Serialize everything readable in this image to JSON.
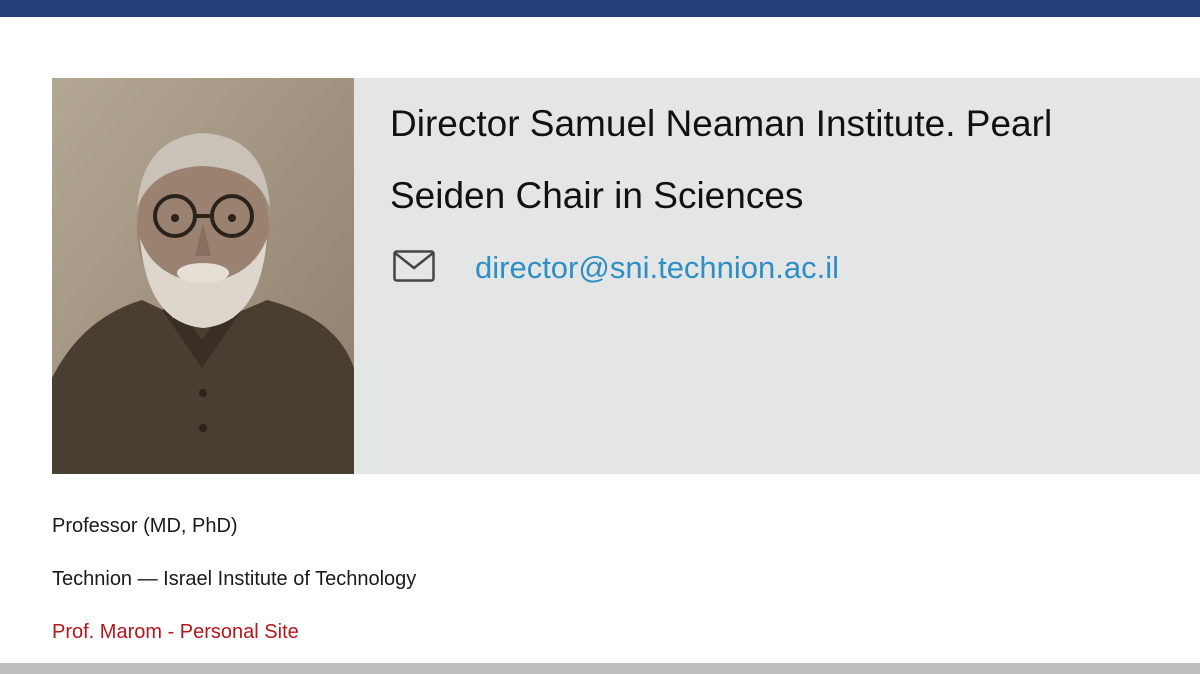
{
  "profile": {
    "title_line1": "Director Samuel Neaman Institute. Pearl",
    "title_line2": "Seiden Chair in Sciences",
    "email": "director@sni.technion.ac.il",
    "degree": "Professor (MD, PhD)",
    "institution": "Technion — Israel Institute of Technology",
    "personal_site_label": "Prof. Marom - Personal Site",
    "photo_icon": "portrait-photo",
    "email_icon": "envelope-icon"
  },
  "colors": {
    "top_bar": "#263f7a",
    "card_background": "#e4e5e5",
    "email_link": "#2e8fc6",
    "personal_link": "#b3171c",
    "bottom_bar": "#bdbdbd"
  }
}
